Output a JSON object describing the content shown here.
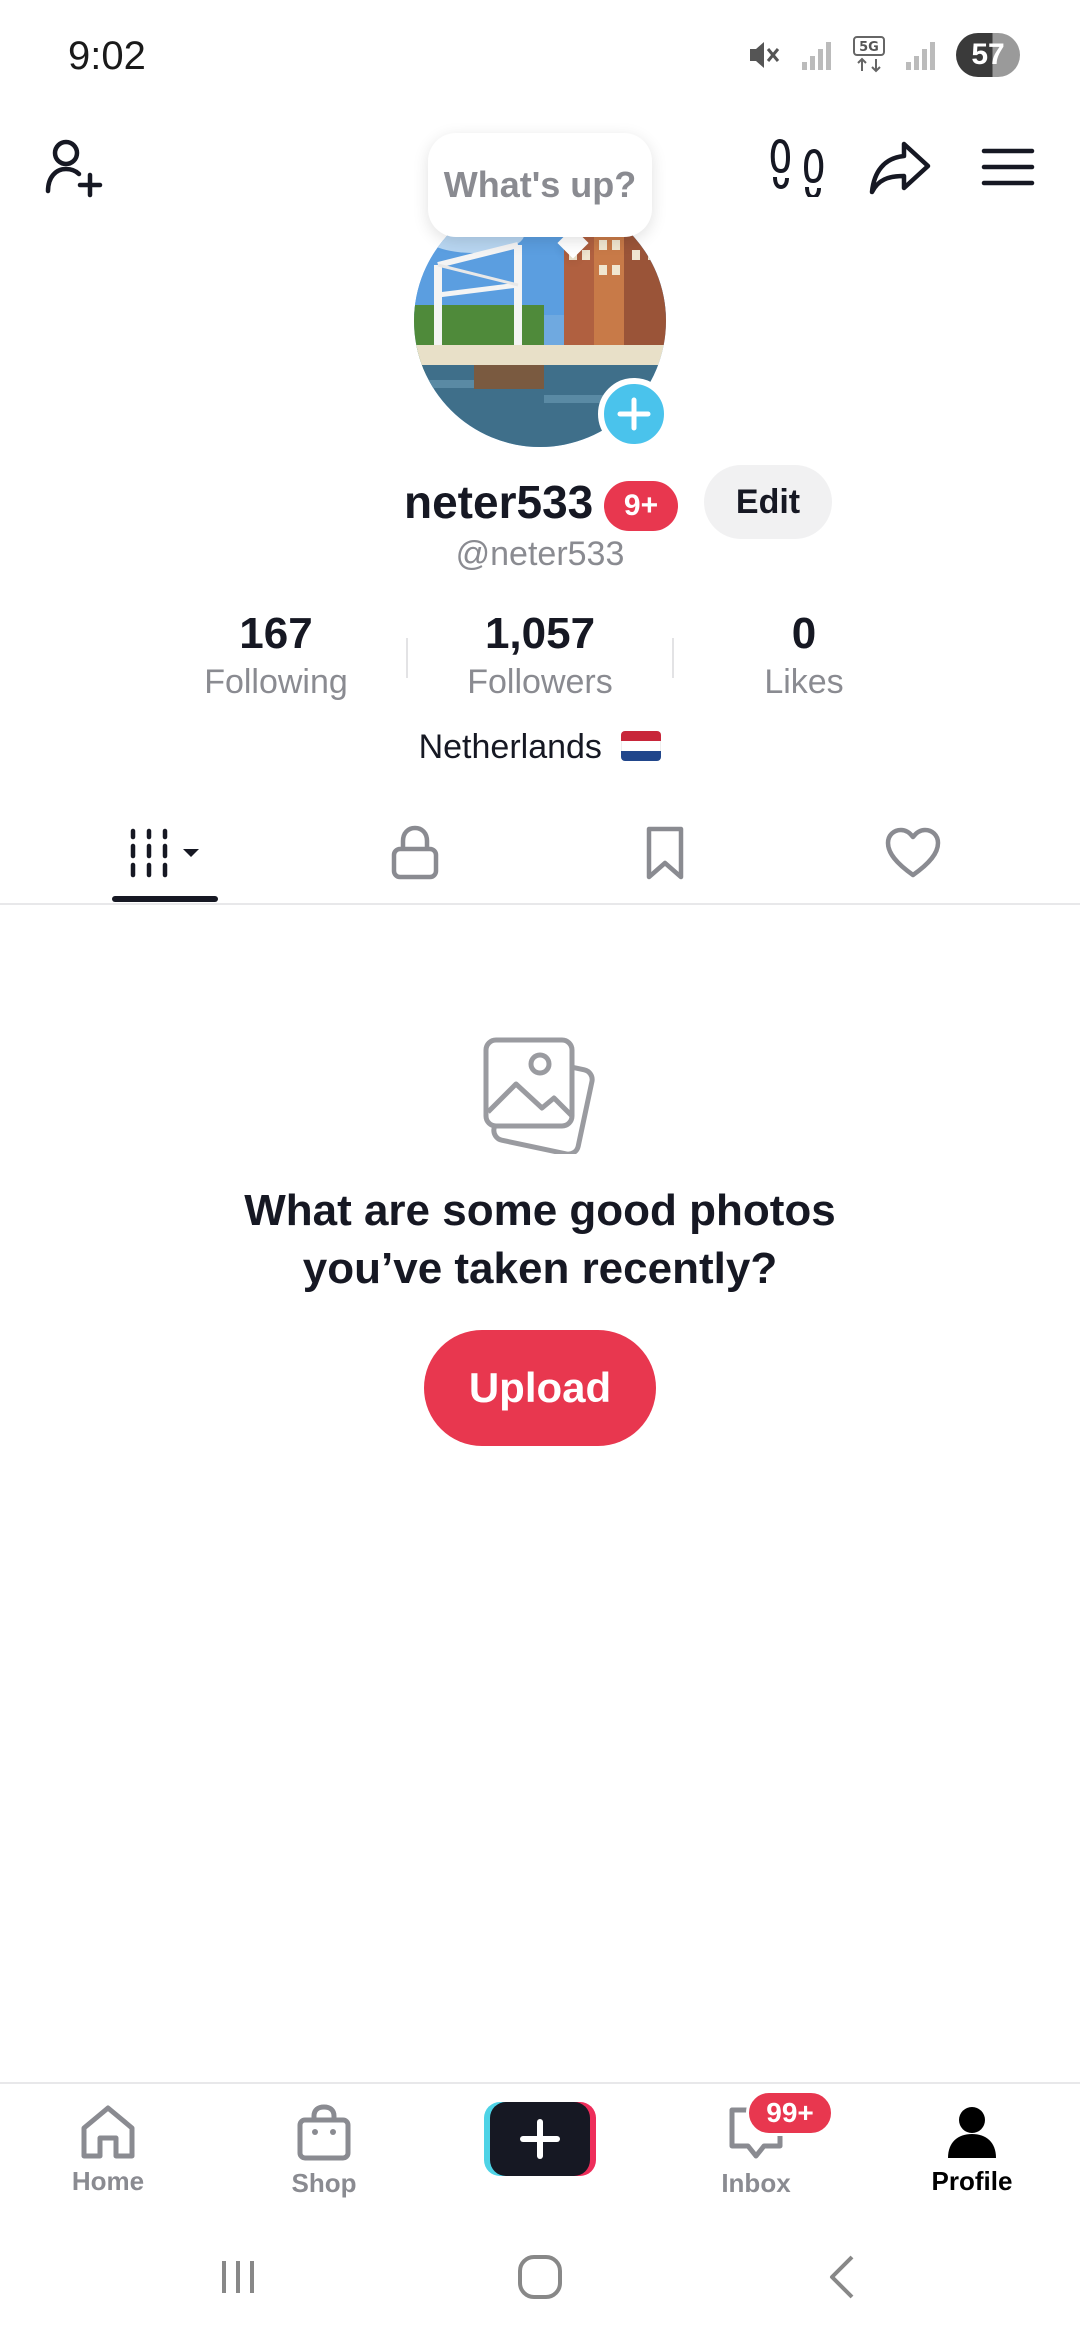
{
  "status_bar": {
    "time": "9:02",
    "battery": "57"
  },
  "header": {
    "bubble_text": "What's up?"
  },
  "profile": {
    "username": "neter533",
    "notification_badge": "9+",
    "edit_label": "Edit",
    "handle": "@neter533",
    "bio": "Netherlands"
  },
  "stats": [
    {
      "value": "167",
      "label": "Following"
    },
    {
      "value": "1,057",
      "label": "Followers"
    },
    {
      "value": "0",
      "label": "Likes"
    }
  ],
  "tabs": [
    {
      "name": "videos",
      "active": true
    },
    {
      "name": "private",
      "active": false
    },
    {
      "name": "saved",
      "active": false
    },
    {
      "name": "liked",
      "active": false
    }
  ],
  "empty_state": {
    "title_line1": "What are some good photos",
    "title_line2": "you’ve taken recently?",
    "button": "Upload"
  },
  "bottom_nav": {
    "home": "Home",
    "shop": "Shop",
    "inbox": "Inbox",
    "inbox_badge": "99+",
    "profile": "Profile"
  },
  "colors": {
    "accent": "#e8374f",
    "avatar_add": "#4ac3ec",
    "muted_text": "#8a8b91"
  }
}
